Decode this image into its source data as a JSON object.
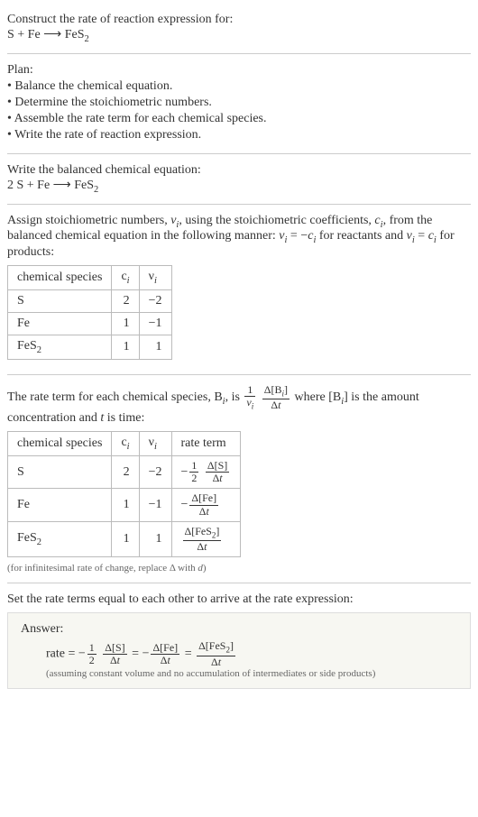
{
  "header": {
    "title": "Construct the rate of reaction expression for:",
    "equation": "S + Fe ⟶ FeS<span class=\"sub\">2</span>"
  },
  "plan": {
    "title": "Plan:",
    "items": [
      "• Balance the chemical equation.",
      "• Determine the stoichiometric numbers.",
      "• Assemble the rate term for each chemical species.",
      "• Write the rate of reaction expression."
    ]
  },
  "balanced": {
    "title": "Write the balanced chemical equation:",
    "equation": "2 S + Fe ⟶ FeS<span class=\"sub\">2</span>"
  },
  "stoich": {
    "intro": "Assign stoichiometric numbers, <i>ν<span class=\"sub\">i</span></i>, using the stoichiometric coefficients, <i>c<span class=\"sub\">i</span></i>, from the balanced chemical equation in the following manner: <i>ν<span class=\"sub\">i</span></i> = −<i>c<span class=\"sub\">i</span></i> for reactants and <i>ν<span class=\"sub\">i</span></i> = <i>c<span class=\"sub\">i</span></i> for products:",
    "headers": [
      "chemical species",
      "c<i><span class=\"sub\">i</span></i>",
      "ν<i><span class=\"sub\">i</span></i>"
    ],
    "rows": [
      {
        "species": "S",
        "c": "2",
        "v": "−2"
      },
      {
        "species": "Fe",
        "c": "1",
        "v": "−1"
      },
      {
        "species": "FeS<span class=\"sub\">2</span>",
        "c": "1",
        "v": "1"
      }
    ]
  },
  "rateterm": {
    "intro_a": "The rate term for each chemical species, B<span class=\"sub\"><i>i</i></span>, is ",
    "intro_b": " where [B<span class=\"sub\"><i>i</i></span>] is the amount concentration and <i>t</i> is time:",
    "headers": [
      "chemical species",
      "c<i><span class=\"sub\">i</span></i>",
      "ν<i><span class=\"sub\">i</span></i>",
      "rate term"
    ],
    "rows": [
      {
        "species": "S",
        "c": "2",
        "v": "−2",
        "term": "−<span class=\"frac\"><span class=\"top\">1</span><span class=\"bot\">2</span></span> <span class=\"frac\"><span class=\"top\">Δ[S]</span><span class=\"bot\">Δ<i>t</i></span></span>"
      },
      {
        "species": "Fe",
        "c": "1",
        "v": "−1",
        "term": "−<span class=\"frac\"><span class=\"top\">Δ[Fe]</span><span class=\"bot\">Δ<i>t</i></span></span>"
      },
      {
        "species": "FeS<span class=\"sub\">2</span>",
        "c": "1",
        "v": "1",
        "term": "<span class=\"frac\"><span class=\"top\">Δ[FeS<span class=\"sub\">2</span>]</span><span class=\"bot\">Δ<i>t</i></span></span>"
      }
    ],
    "note": "(for infinitesimal rate of change, replace Δ with <i>d</i>)"
  },
  "final": {
    "intro": "Set the rate terms equal to each other to arrive at the rate expression:",
    "answer_label": "Answer:",
    "rate_eq": "rate = −<span class=\"frac\"><span class=\"top\">1</span><span class=\"bot\">2</span></span> <span class=\"frac\"><span class=\"top\">Δ[S]</span><span class=\"bot\">Δ<i>t</i></span></span> = −<span class=\"frac\"><span class=\"top\">Δ[Fe]</span><span class=\"bot\">Δ<i>t</i></span></span> = <span class=\"frac\"><span class=\"top\">Δ[FeS<span class=\"sub\">2</span>]</span><span class=\"bot\">Δ<i>t</i></span></span>",
    "assumption": "(assuming constant volume and no accumulation of intermediates or side products)"
  }
}
